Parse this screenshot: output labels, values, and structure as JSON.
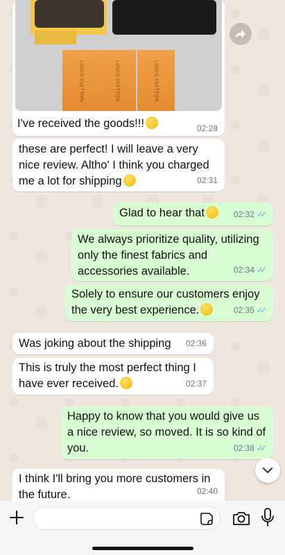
{
  "messages": [
    {
      "id": "m1",
      "direction": "incoming",
      "text": "I've received the goods!!!",
      "time": "02:28",
      "has_image": true,
      "emoji": "star-struck-emoji"
    },
    {
      "id": "m2",
      "direction": "incoming",
      "text": "these are perfect! I will leave a very nice review. Altho' I think you charged me a lot for shipping",
      "time": "02:31",
      "emoji": "monocle-emoji"
    },
    {
      "id": "m3",
      "direction": "outgoing",
      "text": "Glad to hear that",
      "time": "02:32",
      "emoji": "grin-emoji",
      "status": "read"
    },
    {
      "id": "m4",
      "direction": "outgoing",
      "text": "We always prioritize quality, utilizing only the finest fabrics and accessories available.",
      "time": "02:34",
      "status": "read"
    },
    {
      "id": "m5",
      "direction": "outgoing",
      "text": "Solely to ensure our customers enjoy the very best experience.",
      "time": "02:35",
      "emoji": "wink-emoji",
      "status": "read"
    },
    {
      "id": "m6",
      "direction": "incoming",
      "text": "Was joking about the shipping",
      "time": "02:36"
    },
    {
      "id": "m7",
      "direction": "incoming",
      "text": "This is truly the most perfect thing I have ever received.",
      "time": "02:37",
      "emoji": "smile-emoji"
    },
    {
      "id": "m8",
      "direction": "outgoing",
      "text": "Happy to know that you would give us a nice review, so moved. It is so kind of you.",
      "time": "02:38",
      "status": "read"
    },
    {
      "id": "m9",
      "direction": "incoming",
      "text": "I think I'll bring you more customers in the future.",
      "time": "02:40"
    }
  ],
  "photo": {
    "box_label": "LOUIS VUITTON"
  },
  "composer": {
    "placeholder": ""
  },
  "colors": {
    "chat_background": "#efe7dd",
    "incoming_bubble": "#ffffff",
    "outgoing_bubble": "#d9fdd3",
    "read_ticks": "#53bdeb",
    "timestamp": "#667781"
  },
  "icons": {
    "forward": "forward-arrow-icon",
    "scroll_down": "chevron-down-icon",
    "attach": "plus-icon",
    "sticker": "sticker-icon",
    "camera": "camera-icon",
    "mic": "microphone-icon",
    "read_receipt": "double-check-icon"
  }
}
